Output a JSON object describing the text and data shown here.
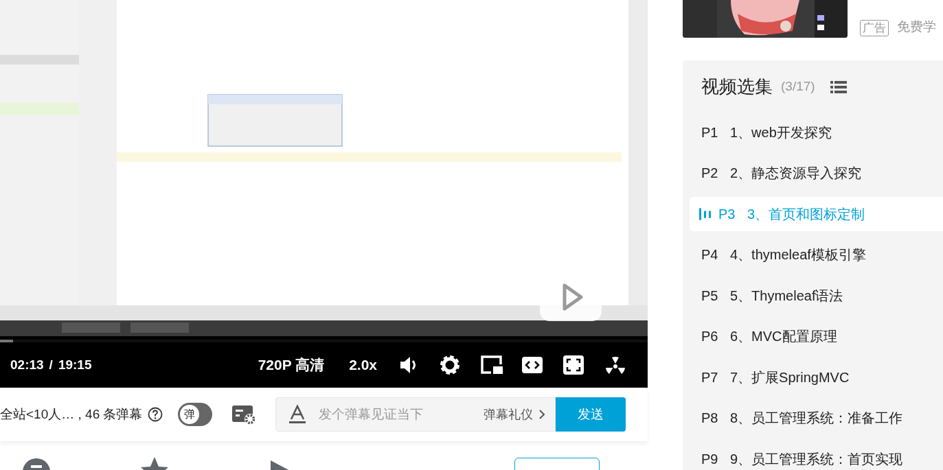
{
  "player": {
    "progress": {
      "level": 0.02
    },
    "time_current": "02:13",
    "time_separator": "/",
    "time_total": "19:15",
    "quality": "720P 高清",
    "speed": "2.0x"
  },
  "danmaku_bar": {
    "info": "全站<10人… , 46 条弹幕",
    "toggle": {
      "label": "弹",
      "on": false
    },
    "input": {
      "placeholder": "发个弹幕见证当下"
    },
    "etiquette": "弹幕礼仪",
    "send": "发送"
  },
  "ad": {
    "badge": "广告",
    "text": "免费学"
  },
  "playlist": {
    "title": "视频选集",
    "count": "(3/17)",
    "items": [
      {
        "part": "P1",
        "title": "1、web开发探究",
        "selected": false
      },
      {
        "part": "P2",
        "title": "2、静态资源导入探究",
        "selected": false
      },
      {
        "part": "P3",
        "title": "3、首页和图标定制",
        "selected": true
      },
      {
        "part": "P4",
        "title": "4、thymeleaf模板引擎",
        "selected": false
      },
      {
        "part": "P5",
        "title": "5、Thymeleaf语法",
        "selected": false
      },
      {
        "part": "P6",
        "title": "6、MVC配置原理",
        "selected": false
      },
      {
        "part": "P7",
        "title": "7、扩展SpringMVC",
        "selected": false
      },
      {
        "part": "P8",
        "title": "8、员工管理系统：准备工作",
        "selected": false
      },
      {
        "part": "P9",
        "title": "9、员工管理系统：首页实现",
        "selected": false
      }
    ]
  }
}
